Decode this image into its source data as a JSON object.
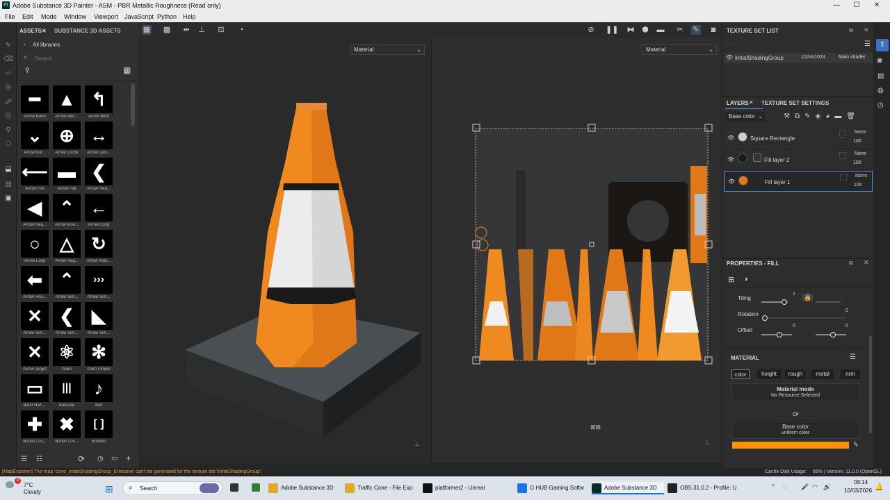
{
  "window": {
    "title": "Adobe Substance 3D Painter - ASM - PBR Metallic Roughness (Read only)",
    "logo": "Pt",
    "minimize": "—",
    "maximize": "☐",
    "close": "✕"
  },
  "menu": [
    "File",
    "Edit",
    "Mode",
    "Window",
    "Viewport",
    "JavaScript",
    "Python",
    "Help"
  ],
  "assets": {
    "tab_assets": "ASSETS",
    "tab_close": "✕",
    "tab_substance": "SUBSTANCE 3D ASSETS",
    "all_libraries": "All libraries",
    "search_placeholder": "Search",
    "items": [
      {
        "label": "Arrow Band",
        "glyph": "━"
      },
      {
        "label": "Arrow Ben...",
        "glyph": "▲"
      },
      {
        "label": "Arrow Benr",
        "glyph": "↰"
      },
      {
        "label": "Arrow Bor...",
        "glyph": "⌄"
      },
      {
        "label": "Arrow Circle",
        "glyph": "⊕"
      },
      {
        "label": "Arrow Dou...",
        "glyph": "↔"
      },
      {
        "label": "Arrow Fire",
        "glyph": "⟵"
      },
      {
        "label": "Arrow Flat",
        "glyph": "▬"
      },
      {
        "label": "Arrow Hea...",
        "glyph": "❮"
      },
      {
        "label": "Arrow Hea...",
        "glyph": "◀"
      },
      {
        "label": "Arrow Inse...",
        "glyph": "⌃"
      },
      {
        "label": "Arrow Long",
        "glyph": "←"
      },
      {
        "label": "Arrow Loop",
        "glyph": "○"
      },
      {
        "label": "Arrow Neg...",
        "glyph": "△"
      },
      {
        "label": "Arrow Rota...",
        "glyph": "↻"
      },
      {
        "label": "Arrow Rou...",
        "glyph": "⬅"
      },
      {
        "label": "Arrow Sim...",
        "glyph": "⌃"
      },
      {
        "label": "Arrow Sim...",
        "glyph": "›››"
      },
      {
        "label": "Arrow Sim...",
        "glyph": "✕"
      },
      {
        "label": "Arrow Sim...",
        "glyph": "❮"
      },
      {
        "label": "Arrow Sim...",
        "glyph": "◣"
      },
      {
        "label": "Arrow Target",
        "glyph": "✕"
      },
      {
        "label": "Atom",
        "glyph": "⚛"
      },
      {
        "label": "Atom Simple",
        "glyph": "✻"
      },
      {
        "label": "Band Half ...",
        "glyph": "▭"
      },
      {
        "label": "Barcode",
        "glyph": "|||"
      },
      {
        "label": "Bell",
        "glyph": "♪"
      },
      {
        "label": "Bones Cro...",
        "glyph": "✚"
      },
      {
        "label": "Bones Cro...",
        "glyph": "✖"
      },
      {
        "label": "Bracket",
        "glyph": "[ ]"
      }
    ]
  },
  "viewport": {
    "left_material": "Material",
    "right_material": "Material"
  },
  "texture_set_list": {
    "title": "TEXTURE SET LIST",
    "name": "initialShadingGroup",
    "resolution": "1024x1024",
    "shader": "Main shader"
  },
  "layers": {
    "tab_layers": "LAYERS",
    "tab_close": "✕",
    "tab_settings": "TEXTURE SET SETTINGS",
    "channel": "Base color",
    "items": [
      {
        "name": "Square Rectangle",
        "blend": "Norm",
        "opacity": "100"
      },
      {
        "name": "Fill layer 2",
        "blend": "Norm",
        "opacity": "100"
      },
      {
        "name": "Fill layer 1",
        "blend": "Norm",
        "opacity": "100"
      }
    ]
  },
  "properties": {
    "title": "PROPERTIES - FILL",
    "tiling_label": "Tiling",
    "tiling_value": "1",
    "rotation_label": "Rotation",
    "rotation_value": "0",
    "offset_label": "Offset",
    "offset_value_1": "0",
    "offset_value_2": "0",
    "material_header": "MATERIAL",
    "channels": [
      "color",
      "height",
      "rough",
      "metal",
      "nrm"
    ],
    "material_mode_label": "Material mode",
    "material_mode_value": "No Resource Selected",
    "or_text": "Or",
    "base_color_label": "Base color",
    "base_color_value": "uniform color",
    "base_color_hex": "#f7930f"
  },
  "status": {
    "message": "[MapExporter] The map 'cone_initialShadingGroup_Emissive' can't be generated for the texture set 'initialShadingGroup'.",
    "cache": "Cache Disk Usage:",
    "cache_value": "66% | Version: 11.0.0 (OpenGL)"
  },
  "taskbar": {
    "weather_temp": "7°C",
    "weather_desc": "Cloudy",
    "badge": "4",
    "search": "Search",
    "apps": [
      {
        "label": "Adobe Substance 3D",
        "color": "#e0a92a"
      },
      {
        "label": "Traffic Cone - File Exp",
        "color": "#e0a92a"
      },
      {
        "label": "platformer2 - Unreal",
        "color": "#111111"
      },
      {
        "label": "G HUB Gaming Softw",
        "color": "#1a73e8"
      },
      {
        "label": "Adobe Substance 3D",
        "color": "#0b2a2a"
      },
      {
        "label": "OBS 31.0.2 - Profile: U",
        "color": "#222222"
      }
    ],
    "time": "09:14",
    "date": "10/03/2026"
  }
}
